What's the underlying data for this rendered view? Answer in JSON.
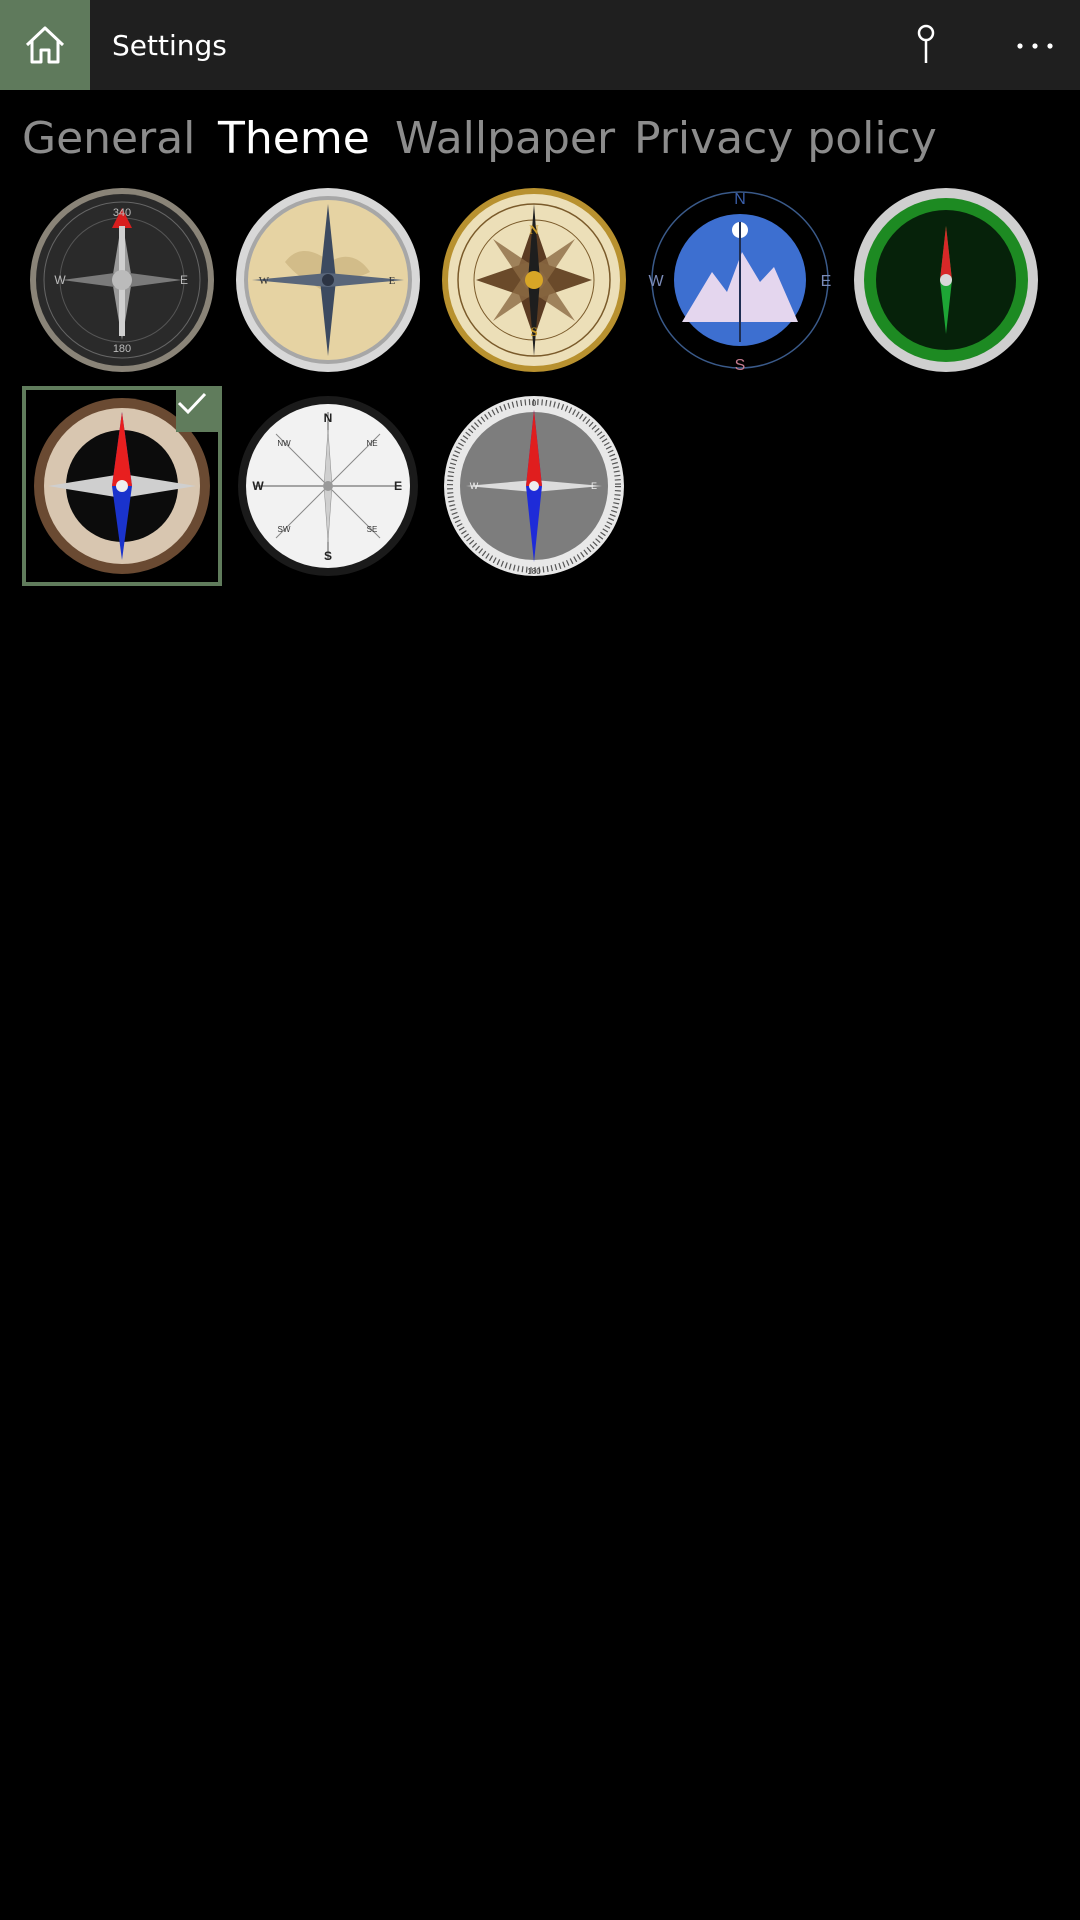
{
  "titlebar": {
    "title": "Settings",
    "home_icon": "home-icon",
    "pin_icon": "pin-icon",
    "more_icon": "more-ellipsis-icon",
    "accent_color": "#5f7a5c"
  },
  "tabs": [
    {
      "label": "General",
      "active": false
    },
    {
      "label": "Theme",
      "active": true
    },
    {
      "label": "Wallpaper",
      "active": false
    },
    {
      "label": "Privacy policy",
      "active": false
    }
  ],
  "themes": {
    "selected_index": 5,
    "items": [
      {
        "name": "dark-classic-compass",
        "labels": {
          "n": "340",
          "w": "W",
          "e": "E",
          "s": "180"
        }
      },
      {
        "name": "gold-world-map-compass",
        "labels": {
          "w": "W",
          "e": "E"
        }
      },
      {
        "name": "antique-rose-compass",
        "labels": {
          "n": "N",
          "s": "S"
        }
      },
      {
        "name": "mountain-night-compass",
        "labels": {
          "n": "N",
          "w": "W",
          "e": "E",
          "s": "S"
        }
      },
      {
        "name": "green-radar-compass",
        "labels": {}
      },
      {
        "name": "bronze-star-compass",
        "labels": {}
      },
      {
        "name": "white-dial-compass",
        "labels": {
          "n": "N",
          "w": "W",
          "e": "E",
          "s": "S",
          "nw": "NW",
          "ne": "NE",
          "sw": "SW",
          "se": "SE"
        }
      },
      {
        "name": "gray-dial-compass",
        "labels": {
          "n": "0",
          "w": "W",
          "e": "E",
          "s": "180"
        }
      }
    ]
  }
}
